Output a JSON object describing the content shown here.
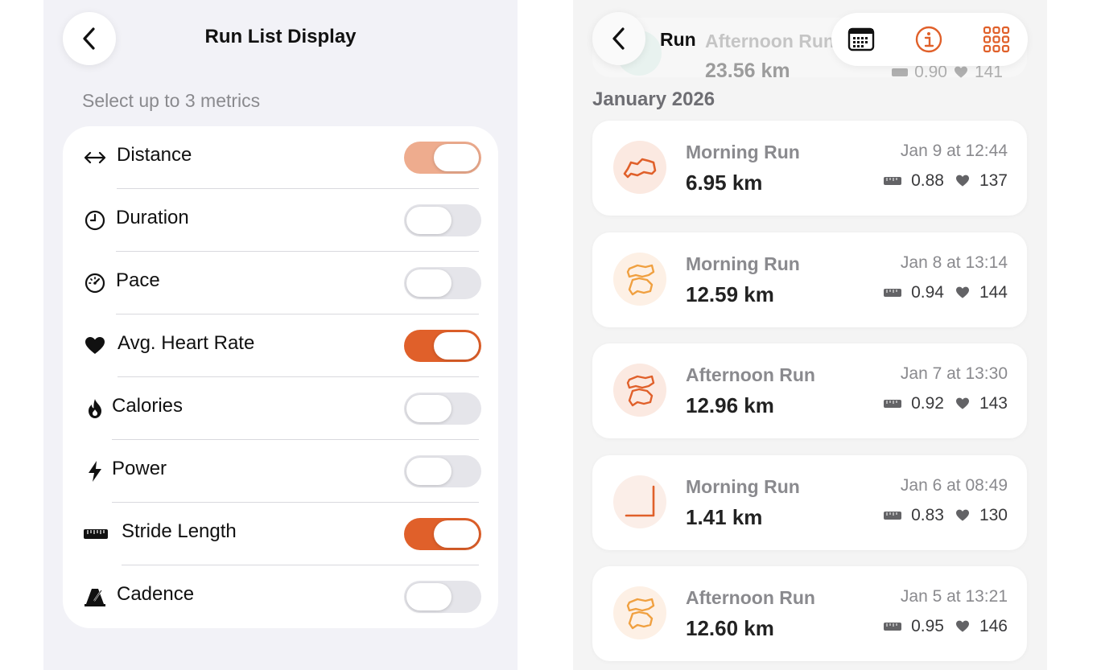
{
  "settings": {
    "title": "Run List Display",
    "subtitle": "Select up to 3 metrics",
    "metrics": [
      {
        "label": "Distance",
        "icon": "arrows-horizontal-icon",
        "state": "on-dimmed"
      },
      {
        "label": "Duration",
        "icon": "clock-icon",
        "state": "off"
      },
      {
        "label": "Pace",
        "icon": "speedometer-icon",
        "state": "off"
      },
      {
        "label": "Avg. Heart Rate",
        "icon": "heart-icon",
        "state": "on"
      },
      {
        "label": "Calories",
        "icon": "flame-icon",
        "state": "off"
      },
      {
        "label": "Power",
        "icon": "bolt-icon",
        "state": "off"
      },
      {
        "label": "Stride Length",
        "icon": "ruler-icon",
        "state": "on"
      },
      {
        "label": "Cadence",
        "icon": "metronome-icon",
        "state": "off"
      }
    ]
  },
  "runs_screen": {
    "title": "Run",
    "partial_run": {
      "name": "Afternoon Run",
      "distance": "23.56 km",
      "stride": "0.90",
      "heart_rate": "141"
    },
    "month": "January 2026",
    "runs": [
      {
        "name": "Morning Run",
        "distance": "6.95 km",
        "date": "Jan 9 at 12:44",
        "stride": "0.88",
        "heart_rate": "137",
        "route_color": "#e0602a"
      },
      {
        "name": "Morning Run",
        "distance": "12.59 km",
        "date": "Jan 8 at 13:14",
        "stride": "0.94",
        "heart_rate": "144",
        "route_color": "#f0a040"
      },
      {
        "name": "Afternoon Run",
        "distance": "12.96 km",
        "date": "Jan 7 at 13:30",
        "stride": "0.92",
        "heart_rate": "143",
        "route_color": "#e0602a"
      },
      {
        "name": "Morning Run",
        "distance": "1.41 km",
        "date": "Jan 6 at 08:49",
        "stride": "0.83",
        "heart_rate": "130",
        "route_color": "#e0602a"
      },
      {
        "name": "Afternoon Run",
        "distance": "12.60 km",
        "date": "Jan 5 at 13:21",
        "stride": "0.95",
        "heart_rate": "146",
        "route_color": "#f0a040"
      }
    ]
  },
  "colors": {
    "accent": "#e0602a",
    "accent_dim": "#eeac8e",
    "toggle_off": "#e5e5ea"
  }
}
